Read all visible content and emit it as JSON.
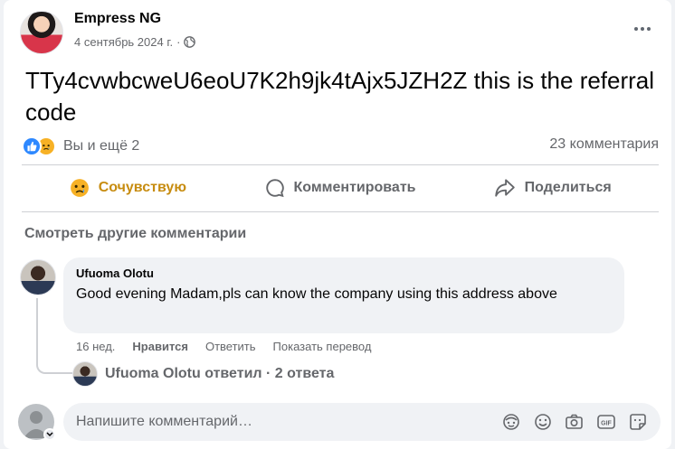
{
  "post": {
    "author": "Empress NG",
    "date": "4 сентябрь 2024 г.",
    "separator": "·",
    "text": "TTy4cvwbcweU6eoU7K2h9jk4tAjx5JZH2Z this is the referral code",
    "reactions_text": "Вы и ещё 2",
    "comments_count": "23 комментария"
  },
  "actions": {
    "sympathize": "Сочувствую",
    "comment": "Комментировать",
    "share": "Поделиться"
  },
  "more_comments": "Смотреть другие комментарии",
  "comment": {
    "author": "Ufuoma Olotu",
    "text": "Good evening Madam,pls can know the company using this address above",
    "time": "16 нед.",
    "like": "Нравится",
    "reply": "Ответить",
    "translate": "Показать перевод"
  },
  "replies": {
    "text": "Ufuoma Olotu ответил · 2 ответа"
  },
  "composer": {
    "placeholder": "Напишите комментарий…"
  },
  "icons": {
    "menu": "more-icon",
    "privacy": "globe-icon",
    "react1": "like-icon",
    "react2": "sad-icon",
    "tools": [
      "avatar-sticker-icon",
      "emoji-icon",
      "camera-icon",
      "gif-icon",
      "sticker-icon"
    ]
  },
  "colors": {
    "accent_sad": "#f7b125",
    "like_blue": "#2d88ff",
    "secondary_text": "#65676b",
    "bubble_bg": "#f0f2f5"
  }
}
